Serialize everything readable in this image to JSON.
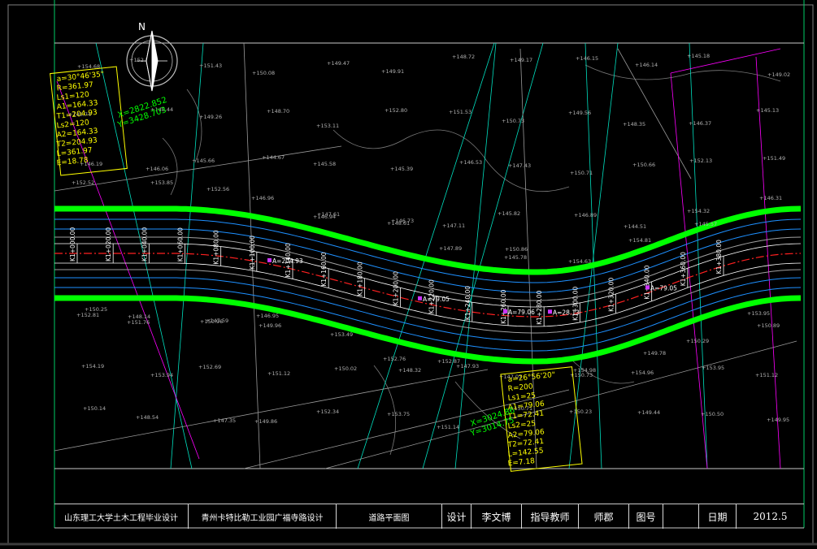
{
  "north_label": "N",
  "colors": {
    "background": "#000000",
    "road_edge": "#00ff00",
    "centerline": "#ff2020",
    "annotation": "#ffff00",
    "station": "#ffffff",
    "frame": "#c8c8c8",
    "magenta": "#ff00ff"
  },
  "curve_left": {
    "lines": [
      "a=30°46'35\"",
      "R=361.97",
      "Ls1=120",
      "A1=164.33",
      "T1=204.93",
      "Ls2=120",
      "A2=164.33",
      "T2=204.93",
      "L=361.97",
      "E=18.78"
    ],
    "coord_x": "X=2822.852",
    "coord_y": "Y=3428.703"
  },
  "curve_right": {
    "lines": [
      "a=26°56'20\"",
      "R=200",
      "Ls1=25",
      "A1=79.06",
      "T1=72.41",
      "Ls2=25",
      "A2=79.06",
      "T2=72.41",
      "L=142.55",
      "E=7.18"
    ],
    "coord_x": "X=3024.86",
    "coord_y": "Y=3014.75"
  },
  "stations": [
    "K1+000.00",
    "K1+020.00",
    "K1+040.00",
    "K1+060.00",
    "K1+080.00",
    "K1+100.00",
    "K1+140.00",
    "K1+160.00",
    "K1+180.00",
    "K1+200.00",
    "K1+220.00",
    "K1+240.00",
    "K1+260.00",
    "K1+280.00",
    "K1+300.00",
    "K1+320.00",
    "K1+340.00",
    "K1+360.00",
    "K1+380.00"
  ],
  "curve_marks": [
    "A=204.93",
    "A=79.05",
    "A=79.06",
    "A=28.13",
    "A=79.05"
  ],
  "elevations": [
    "154.68",
    "152.53",
    "151.43",
    "150.08",
    "149.47",
    "149.91",
    "148.72",
    "149.17",
    "146.15",
    "146.14",
    "145.18",
    "149.02",
    "148.74",
    "148.44",
    "149.26",
    "148.70",
    "153.11",
    "152.80",
    "151.53",
    "150.73",
    "149.56",
    "148.35",
    "146.37",
    "145.13",
    "146.19",
    "146.06",
    "145.66",
    "144.67",
    "145.58",
    "145.39",
    "146.53",
    "147.43",
    "150.71",
    "150.66",
    "152.13",
    "151.49",
    "152.52",
    "153.85",
    "152.56",
    "146.96",
    "147.61",
    "146.73",
    "147.11",
    "145.82",
    "146.89",
    "144.51",
    "145.57",
    "146.31",
    "150.25",
    "148.14",
    "147.59",
    "146.95",
    "146.94",
    "148.61",
    "147.89",
    "145.78",
    "154.63",
    "154.81",
    "154.32",
    "153.95",
    "152.81",
    "151.76",
    "150.96",
    "149.96",
    "153.49",
    "152.76",
    "152.87",
    "150.86",
    "150.73",
    "149.78",
    "150.29",
    "150.89",
    "154.19",
    "153.94",
    "152.69",
    "151.12",
    "150.02",
    "148.32",
    "147.93",
    "147.07",
    "154.98",
    "154.96",
    "153.95",
    "151.12",
    "150.14",
    "148.54",
    "147.35",
    "149.86",
    "152.34",
    "153.75",
    "151.14",
    "150.71",
    "150.23",
    "149.44",
    "150.50",
    "149.95"
  ],
  "title_block": {
    "school": "山东理工大学土木工程毕业设计",
    "project": "青州卡特比勒工业园广福寺路设计",
    "drawing_name": "道路平面图",
    "design_label": "设计",
    "designer": "李文博",
    "advisor_label": "指导教师",
    "advisor": "师郡",
    "drawing_no_label": "图号",
    "drawing_no": "",
    "date_label": "日期",
    "date": "2012.5"
  }
}
